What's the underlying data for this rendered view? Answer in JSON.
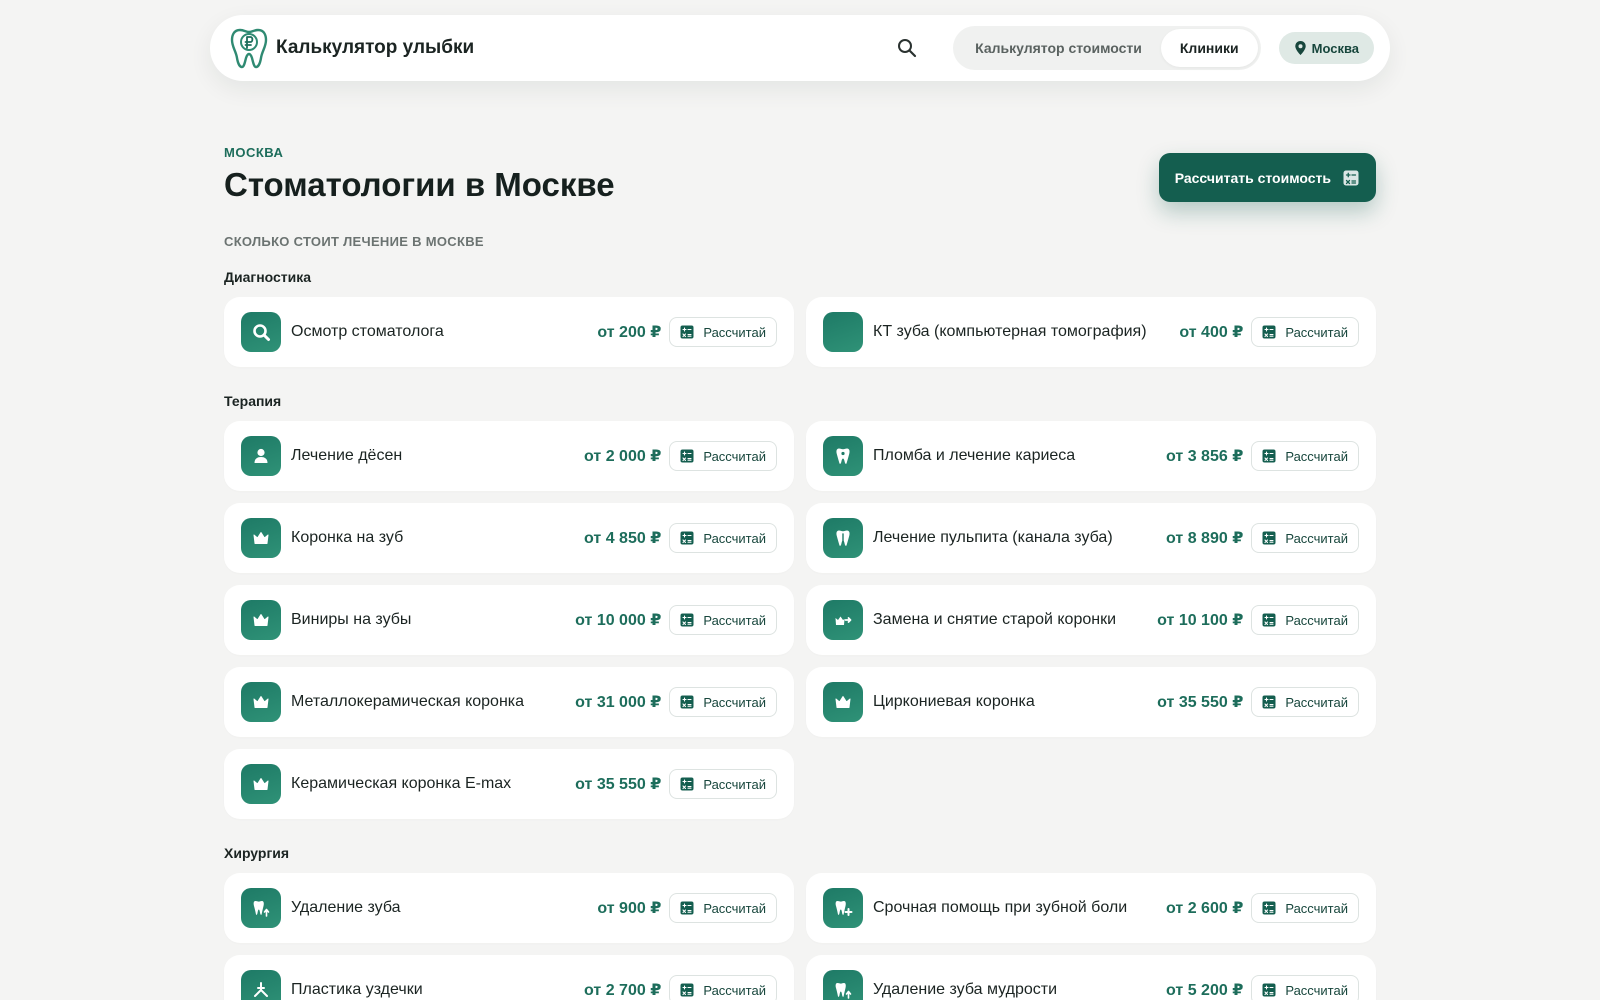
{
  "header": {
    "logo_text": "Калькулятор улыбки",
    "nav": [
      {
        "label": "Калькулятор стоимости",
        "active": false
      },
      {
        "label": "Клиники",
        "active": true
      }
    ],
    "city": "Москва"
  },
  "main": {
    "eyebrow": "МОСКВА",
    "title": "Стоматологии в Москве",
    "cta_label": "Рассчитать стоимость",
    "subheading": "СКОЛЬКО СТОИТ ЛЕЧЕНИЕ В МОСКВЕ",
    "sections": [
      {
        "title": "Диагностика",
        "items": [
          {
            "name": "Осмотр стоматолога",
            "price": "от 200 ₽",
            "action": "Рассчитай",
            "icon": "magnifier-icon"
          },
          {
            "name": "КТ зуба (компьютерная томография)",
            "price": "от 400 ₽",
            "action": "Рассчитай",
            "icon": "blank-icon"
          }
        ]
      },
      {
        "title": "Терапия",
        "items": [
          {
            "name": "Лечение дёсен",
            "price": "от 2 000 ₽",
            "action": "Рассчитай",
            "icon": "gum-icon"
          },
          {
            "name": "Пломба и лечение кариеса",
            "price": "от 3 856 ₽",
            "action": "Рассчитай",
            "icon": "tooth-icon"
          },
          {
            "name": "Коронка на зуб",
            "price": "от 4 850 ₽",
            "action": "Рассчитай",
            "icon": "crown-icon"
          },
          {
            "name": "Лечение пульпита (канала зуба)",
            "price": "от 8 890 ₽",
            "action": "Рассчитай",
            "icon": "tooth-canal-icon"
          },
          {
            "name": "Виниры на зубы",
            "price": "от 10 000 ₽",
            "action": "Рассчитай",
            "icon": "crown-icon"
          },
          {
            "name": "Замена и снятие старой коронки",
            "price": "от 10 100 ₽",
            "action": "Рассчитай",
            "icon": "crown-swap-icon"
          },
          {
            "name": "Металлокерамическая коронка",
            "price": "от 31 000 ₽",
            "action": "Рассчитай",
            "icon": "crown-icon"
          },
          {
            "name": "Циркониевая коронка",
            "price": "от 35 550 ₽",
            "action": "Рассчитай",
            "icon": "crown-icon"
          },
          {
            "name": "Керамическая коронка E-max",
            "price": "от 35 550 ₽",
            "action": "Рассчитай",
            "icon": "crown-icon"
          }
        ]
      },
      {
        "title": "Хирургия",
        "items": [
          {
            "name": "Удаление зуба",
            "price": "от 900 ₽",
            "action": "Рассчитай",
            "icon": "tooth-extract-icon"
          },
          {
            "name": "Срочная помощь при зубной боли",
            "price": "от 2 600 ₽",
            "action": "Рассчитай",
            "icon": "tooth-plus-icon"
          },
          {
            "name": "Пластика уздечки",
            "price": "от 2 700 ₽",
            "action": "Рассчитай",
            "icon": "frenulum-icon"
          },
          {
            "name": "Удаление зуба мудрости",
            "price": "от 5 200 ₽",
            "action": "Рассчитай",
            "icon": "tooth-extract-icon"
          }
        ]
      }
    ]
  },
  "colors": {
    "accent": "#145e4f",
    "price": "#1d6d5b",
    "background": "#f4f4f3"
  }
}
